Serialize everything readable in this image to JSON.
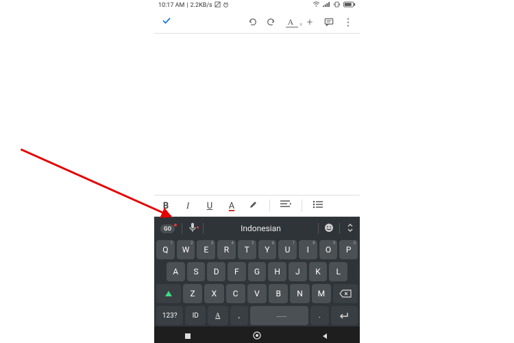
{
  "status": {
    "time": "10:17 AM",
    "speed": "2.2KB/s",
    "icons": {
      "nosim": "⊘",
      "alarm": "⏰",
      "wifi": "wifi",
      "signal": "signal",
      "vibrate": "vibrate",
      "battery": "80"
    }
  },
  "toolbar": {
    "confirm": "✓",
    "undo": "↶",
    "redo": "↷",
    "textfmt": "A",
    "add": "+",
    "comment": "comment",
    "more": "⋮"
  },
  "format": {
    "bold": "B",
    "italic": "I",
    "underline": "U",
    "color": "A",
    "highlight": "highlight",
    "align": "align",
    "bullets": "bullets"
  },
  "keyboard": {
    "suggest_pill": "GO",
    "language": "Indonesian",
    "row1": [
      "Q",
      "W",
      "E",
      "R",
      "T",
      "Y",
      "U",
      "I",
      "O",
      "P"
    ],
    "hints1": [
      "1",
      "2",
      "3",
      "4",
      "5",
      "6",
      "7",
      "8",
      "9",
      "0"
    ],
    "row2": [
      "A",
      "S",
      "D",
      "F",
      "G",
      "H",
      "J",
      "K",
      "L"
    ],
    "row3": [
      "Z",
      "X",
      "C",
      "V",
      "B",
      "N",
      "M"
    ],
    "numkey": "123?",
    "idkey": "ID",
    "langkey_icon": "A",
    "comma": ",",
    "period": ".",
    "enter": "↵"
  },
  "nav": {
    "recent": "■",
    "home": "○",
    "back": "◀"
  }
}
